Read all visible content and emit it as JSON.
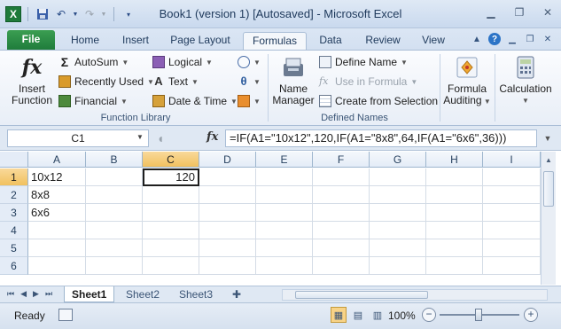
{
  "window": {
    "title": "Book1 (version 1) [Autosaved] - Microsoft Excel",
    "app_icon": "X"
  },
  "tabs": [
    "File",
    "Home",
    "Insert",
    "Page Layout",
    "Formulas",
    "Data",
    "Review",
    "View"
  ],
  "active_tab": "Formulas",
  "ribbon": {
    "insert_function": {
      "line1": "Insert",
      "line2": "Function"
    },
    "autosum": "AutoSum",
    "recently_used": "Recently Used",
    "financial": "Financial",
    "logical": "Logical",
    "text": "Text",
    "date_time": "Date & Time",
    "function_library_label": "Function Library",
    "name_manager": {
      "line1": "Name",
      "line2": "Manager"
    },
    "define_name": "Define Name",
    "use_in_formula": "Use in Formula",
    "create_from_selection": "Create from Selection",
    "defined_names_label": "Defined Names",
    "formula_auditing": {
      "line1": "Formula",
      "line2": "Auditing"
    },
    "calculation": "Calculation"
  },
  "formula_bar": {
    "name_box": "C1",
    "fx": "fx",
    "formula": "=IF(A1=\"10x12\",120,IF(A1=\"8x8\",64,IF(A1=\"6x6\",36)))"
  },
  "grid": {
    "columns": [
      "A",
      "B",
      "C",
      "D",
      "E",
      "F",
      "G",
      "H",
      "I"
    ],
    "rows": [
      "1",
      "2",
      "3",
      "4",
      "5",
      "6"
    ],
    "selected_column": "C",
    "selected_row": "1",
    "cells": {
      "A1": "10x12",
      "A2": "8x8",
      "A3": "6x6",
      "C1": "120"
    }
  },
  "sheets": [
    "Sheet1",
    "Sheet2",
    "Sheet3"
  ],
  "active_sheet": "Sheet1",
  "status": {
    "ready": "Ready",
    "zoom": "100%",
    "minus": "−",
    "plus": "+"
  }
}
